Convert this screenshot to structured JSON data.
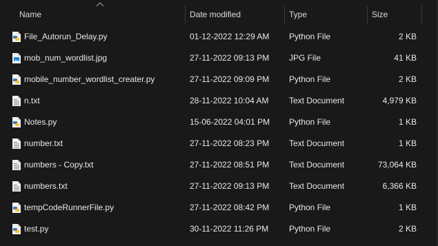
{
  "columns": {
    "name": "Name",
    "date_modified": "Date modified",
    "type": "Type",
    "size": "Size"
  },
  "files": [
    {
      "name": "File_Autorun_Delay.py",
      "date": "01-12-2022 12:29 AM",
      "type": "Python File",
      "size": "2 KB",
      "icon": "python-file-icon"
    },
    {
      "name": "mob_num_wordlist.jpg",
      "date": "27-11-2022 09:13 PM",
      "type": "JPG File",
      "size": "41 KB",
      "icon": "image-file-icon"
    },
    {
      "name": "mobile_number_wordlist_creater.py",
      "date": "27-11-2022 09:09 PM",
      "type": "Python File",
      "size": "2 KB",
      "icon": "python-file-icon"
    },
    {
      "name": "n.txt",
      "date": "28-11-2022 10:04 AM",
      "type": "Text Document",
      "size": "4,979 KB",
      "icon": "text-file-icon"
    },
    {
      "name": "Notes.py",
      "date": "15-06-2022 04:01 PM",
      "type": "Python File",
      "size": "1 KB",
      "icon": "python-file-icon"
    },
    {
      "name": "number.txt",
      "date": "27-11-2022 08:23 PM",
      "type": "Text Document",
      "size": "1 KB",
      "icon": "text-file-icon"
    },
    {
      "name": "numbers - Copy.txt",
      "date": "27-11-2022 08:51 PM",
      "type": "Text Document",
      "size": "73,064 KB",
      "icon": "text-file-icon"
    },
    {
      "name": "numbers.txt",
      "date": "27-11-2022 09:13 PM",
      "type": "Text Document",
      "size": "6,366 KB",
      "icon": "text-file-icon"
    },
    {
      "name": "tempCodeRunnerFile.py",
      "date": "27-11-2022 08:42 PM",
      "type": "Python File",
      "size": "1 KB",
      "icon": "python-file-icon"
    },
    {
      "name": "test.py",
      "date": "30-11-2022 11:26 PM",
      "type": "Python File",
      "size": "2 KB",
      "icon": "python-file-icon"
    }
  ]
}
